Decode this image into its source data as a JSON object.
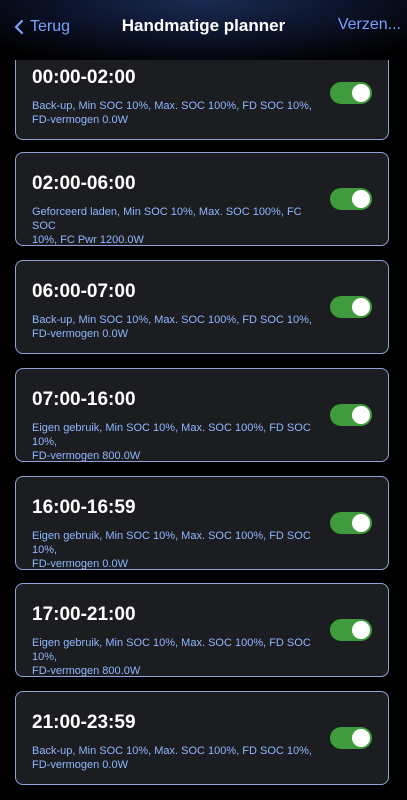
{
  "header": {
    "back_label": "Terug",
    "title": "Handmatige planner",
    "send_label": "Verzen..."
  },
  "colors": {
    "accent": "#7aa2ff",
    "toggle_on": "#3f9b3c",
    "card_border": "#8fa3d6",
    "card_bg": "#1c1d21",
    "description": "#8fb8ff"
  },
  "schedules": [
    {
      "time": "00:00-02:00",
      "line1": "Back-up, Min SOC 10%, Max. SOC 100%, FD SOC 10%,",
      "line2": "FD-vermogen 0.0W",
      "enabled": true
    },
    {
      "time": "02:00-06:00",
      "line1": "Geforceerd laden, Min SOC 10%, Max. SOC 100%, FC SOC",
      "line2": "10%, FC Pwr 1200.0W",
      "enabled": true
    },
    {
      "time": "06:00-07:00",
      "line1": "Back-up, Min SOC 10%, Max. SOC 100%, FD SOC 10%,",
      "line2": "FD-vermogen 0.0W",
      "enabled": true
    },
    {
      "time": "07:00-16:00",
      "line1": "Eigen gebruik, Min SOC 10%, Max. SOC 100%, FD SOC 10%,",
      "line2": "FD-vermogen 800.0W",
      "enabled": true
    },
    {
      "time": "16:00-16:59",
      "line1": "Eigen gebruik, Min SOC 10%, Max. SOC 100%, FD SOC 10%,",
      "line2": "FD-vermogen 0.0W",
      "enabled": true
    },
    {
      "time": "17:00-21:00",
      "line1": "Eigen gebruik, Min SOC 10%, Max. SOC 100%, FD SOC 10%,",
      "line2": "FD-vermogen 800.0W",
      "enabled": true
    },
    {
      "time": "21:00-23:59",
      "line1": "Back-up, Min SOC 10%, Max. SOC 100%, FD SOC 10%,",
      "line2": "FD-vermogen 0.0W",
      "enabled": true
    }
  ]
}
